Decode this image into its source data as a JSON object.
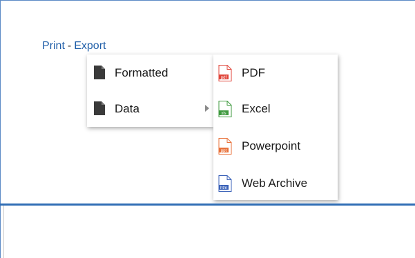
{
  "links": {
    "print": "Print",
    "separator": "-",
    "export": "Export"
  },
  "export_menu": {
    "items": [
      {
        "label": "Formatted",
        "icon": "document-icon"
      },
      {
        "label": "Data",
        "icon": "document-icon",
        "has_submenu": true
      }
    ]
  },
  "data_submenu": {
    "items": [
      {
        "label": "PDF",
        "icon": "pdf-file-icon",
        "badge": "pdf",
        "color": "#e0463b"
      },
      {
        "label": "Excel",
        "icon": "excel-file-icon",
        "badge": "xls",
        "color": "#3f9a3f"
      },
      {
        "label": "Powerpoint",
        "icon": "powerpoint-file-icon",
        "badge": "ppt",
        "color": "#e8713a"
      },
      {
        "label": "Web Archive",
        "icon": "web-archive-file-icon",
        "badge": "htm",
        "color": "#3b62b8"
      }
    ]
  },
  "colors": {
    "link": "#1f5ea8",
    "divider": "#2f6db5",
    "frame": "#5b8ac6",
    "doc_icon": "#3a3a3a"
  }
}
